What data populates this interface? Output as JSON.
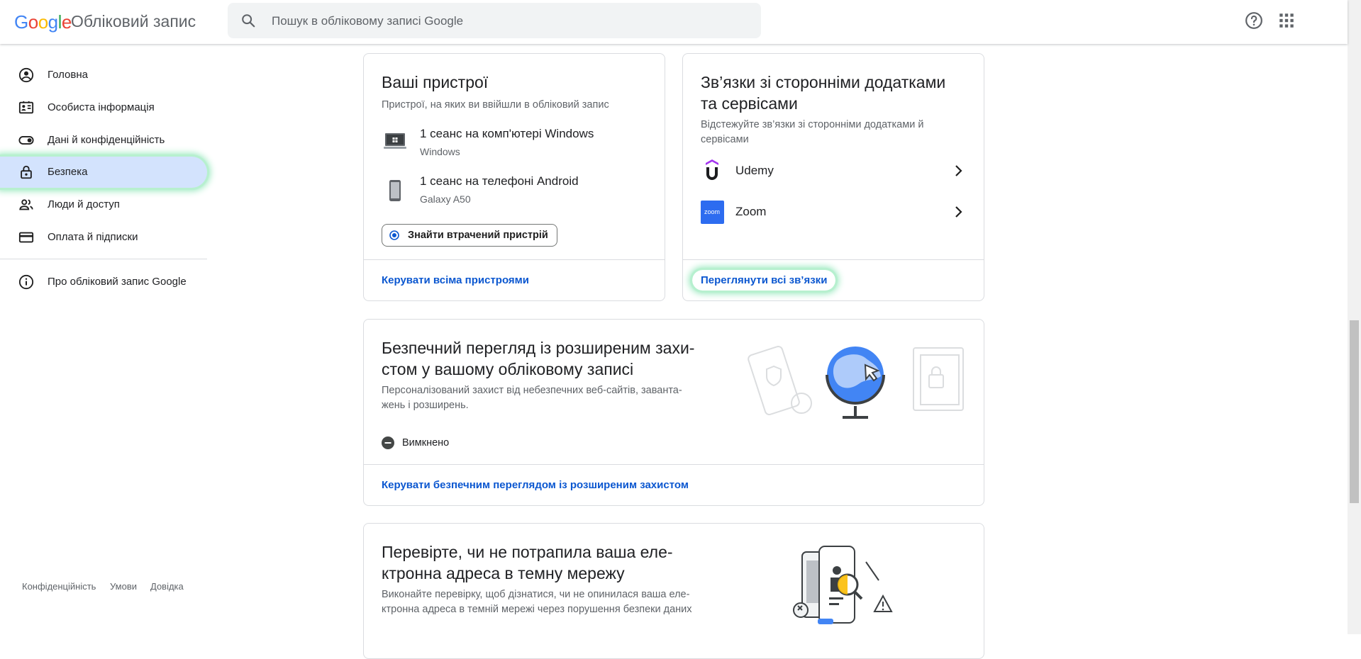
{
  "header": {
    "logo": [
      "G",
      "o",
      "o",
      "g",
      "l",
      "e"
    ],
    "product": "Обліковий запис",
    "search_placeholder": "Пошук в обліковому записі Google"
  },
  "sidebar": {
    "items": [
      {
        "label": "Головна",
        "icon": "account-circle-icon"
      },
      {
        "label": "Особиста інформація",
        "icon": "id-card-icon"
      },
      {
        "label": "Дані й конфіденційність",
        "icon": "toggle-icon"
      },
      {
        "label": "Безпека",
        "icon": "lock-icon"
      },
      {
        "label": "Люди й доступ",
        "icon": "people-icon"
      },
      {
        "label": "Оплата й підписки",
        "icon": "credit-card-icon"
      }
    ],
    "about": {
      "label": "Про обліковий запис Google",
      "icon": "info-icon"
    },
    "footer": [
      "Конфіденційність",
      "Умови",
      "Довідка"
    ]
  },
  "devices_card": {
    "title": "Ваші пристрої",
    "desc": "Пристрої, на яких ви ввійшли в обліковий запис",
    "devices": [
      {
        "title": "1 сеанс на комп'ютері Windows",
        "sub": "Windows",
        "icon": "laptop-icon"
      },
      {
        "title": "1 сеанс на телефоні Android",
        "sub": "Galaxy A50",
        "icon": "phone-icon"
      }
    ],
    "find_button": "Знайти втрачений пристрій",
    "link": "Керувати всіма пристроями"
  },
  "connections_card": {
    "title_line1": "Зв’язки зі сторонніми додатками",
    "title_line2": "та сервісами",
    "desc_line1": "Відстежуйте зв’язки зі сторонніми додатками й",
    "desc_line2": "сервісами",
    "apps": [
      {
        "name": "Udemy",
        "icon": "udemy-logo-icon"
      },
      {
        "name": "Zoom",
        "icon": "zoom-logo-icon",
        "logo_text": "zoom"
      }
    ],
    "link": "Переглянути всі зв’язки"
  },
  "safe_browsing_card": {
    "title_line1": "Безпечний перегляд із розширеним захи-",
    "title_line2": "стом у вашому обліковому записі",
    "desc_line1": "Персоналізований захист від небезпечних веб-сайтів, заванта-",
    "desc_line2": "жень і розширень.",
    "status": "Вимкнено",
    "link": "Керувати безпечним переглядом із розширеним захистом"
  },
  "dark_web_card": {
    "title_line1": "Перевірте, чи не потрапила ваша еле-",
    "title_line2": "ктронна адреса в темну мережу",
    "desc_line1": "Виконайте перевірку, щоб дізнатися, чи не опинилася ваша еле-",
    "desc_line2": "ктронна адреса в темній мережі через порушення безпеки даних"
  },
  "colors": {
    "accent": "#0b57d0",
    "active_nav": "#d3e3fd",
    "highlight": "#8fe6b8"
  }
}
